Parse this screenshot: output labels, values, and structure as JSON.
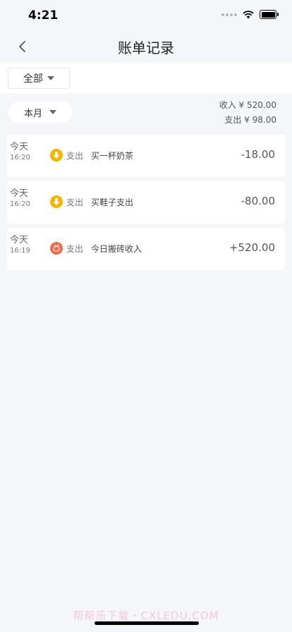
{
  "status": {
    "time": "4:21"
  },
  "nav": {
    "title": "账单记录",
    "back_icon": "chevron-left-icon"
  },
  "filter": {
    "category": "全部",
    "period": "本月"
  },
  "summary": {
    "income": "收入 ¥ 520.00",
    "expense": "支出 ¥ 98.00"
  },
  "records": [
    {
      "day": "今天",
      "time": "16:20",
      "type": "支出",
      "desc": "买一杯奶茶",
      "amount": "-18.00",
      "icon": "expense-down-arrow-icon",
      "icon_color": "#f5b400"
    },
    {
      "day": "今天",
      "time": "16:20",
      "type": "支出",
      "desc": "买鞋子支出",
      "amount": "-80.00",
      "icon": "expense-down-arrow-icon",
      "icon_color": "#f5b400"
    },
    {
      "day": "今天",
      "time": "16:19",
      "type": "支出",
      "desc": "今日搬砖收入",
      "amount": "+520.00",
      "icon": "income-bag-icon",
      "icon_color": "#ee6a4c"
    }
  ],
  "watermark": "帮帮乐下载・CXLEDU.COM"
}
